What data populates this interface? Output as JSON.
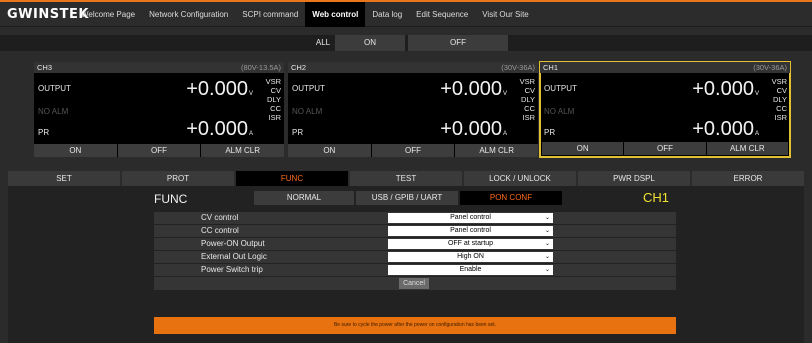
{
  "brand": {
    "logo_text": "GWINSTEK",
    "accent": "#e8761c"
  },
  "nav": {
    "items": [
      {
        "label": "Welcome Page"
      },
      {
        "label": "Network Configuration"
      },
      {
        "label": "SCPI command"
      },
      {
        "label": "Web control"
      },
      {
        "label": "Data log"
      },
      {
        "label": "Edit Sequence"
      },
      {
        "label": "Visit Our Site"
      }
    ],
    "active": "Web control"
  },
  "all_control": {
    "label": "ALL",
    "on_label": "ON",
    "off_label": "OFF"
  },
  "channels": [
    {
      "name": "CH3",
      "range": "(80V-13.5A)",
      "output_label": "OUTPUT",
      "alarm_label": "NO ALM",
      "pr_label": "PR",
      "voltage": "+0.000",
      "voltage_unit": "V",
      "current": "+0.000",
      "current_unit": "A",
      "flags": [
        "VSR",
        "CV",
        "DLY",
        "CC",
        "ISR"
      ],
      "on_label": "ON",
      "off_label": "OFF",
      "almclr_label": "ALM CLR",
      "selected": false
    },
    {
      "name": "CH2",
      "range": "(30V-36A)",
      "output_label": "OUTPUT",
      "alarm_label": "NO ALM",
      "pr_label": "PR",
      "voltage": "+0.000",
      "voltage_unit": "V",
      "current": "+0.000",
      "current_unit": "A",
      "flags": [
        "VSR",
        "CV",
        "DLY",
        "CC",
        "ISR"
      ],
      "on_label": "ON",
      "off_label": "OFF",
      "almclr_label": "ALM CLR",
      "selected": false
    },
    {
      "name": "CH1",
      "range": "(30V-36A)",
      "output_label": "OUTPUT",
      "alarm_label": "NO ALM",
      "pr_label": "PR",
      "voltage": "+0.000",
      "voltage_unit": "V",
      "current": "+0.000",
      "current_unit": "A",
      "flags": [
        "VSR",
        "CV",
        "DLY",
        "CC",
        "ISR"
      ],
      "on_label": "ON",
      "off_label": "OFF",
      "almclr_label": "ALM CLR",
      "selected": true
    }
  ],
  "tabs": [
    {
      "label": "SET"
    },
    {
      "label": "PROT"
    },
    {
      "label": "FUNC"
    },
    {
      "label": "TEST"
    },
    {
      "label": "LOCK / UNLOCK"
    },
    {
      "label": "PWR DSPL"
    },
    {
      "label": "ERROR"
    }
  ],
  "active_tab": "FUNC",
  "func": {
    "title": "FUNC",
    "subtabs": [
      {
        "label": "NORMAL"
      },
      {
        "label": "USB / GPIB / UART"
      },
      {
        "label": "PON CONF"
      }
    ],
    "active_subtab": "PON CONF",
    "channel": "CH1",
    "rows": [
      {
        "label": "CV control",
        "value": "Panel control"
      },
      {
        "label": "CC control",
        "value": "Panel control"
      },
      {
        "label": "Power-ON Output",
        "value": "OFF at startup"
      },
      {
        "label": "External Out Logic",
        "value": "High ON"
      },
      {
        "label": "Power Switch trip",
        "value": "Enable"
      }
    ],
    "cancel_label": "Cancel",
    "notice": "Be sure to cycle the power after the power on configuration has been set."
  },
  "colors": {
    "active_tab_text": "#ff6a1a",
    "selected_channel_border": "#e2c034",
    "channel_label": "#f0e030",
    "notice_bg": "#e8720f"
  }
}
